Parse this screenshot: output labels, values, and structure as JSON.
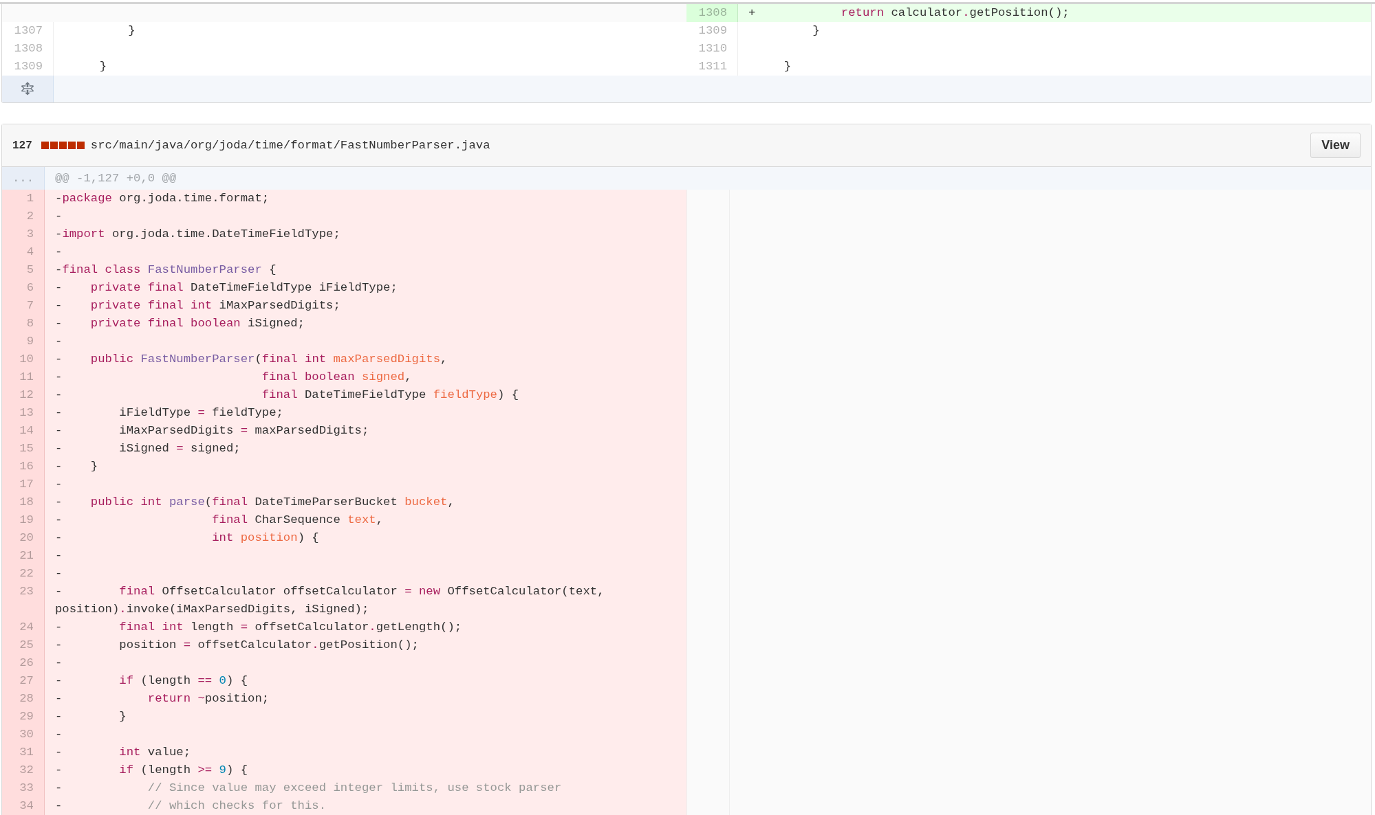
{
  "previous_file_tail": {
    "rows": [
      {
        "right": {
          "kind": "added",
          "number": "1308",
          "code": [
            {
              "kind": "plain",
              "text": "+            "
            },
            {
              "kind": "keyword",
              "text": "return"
            },
            {
              "kind": "plain",
              "text": " calculator"
            },
            {
              "kind": "operator",
              "text": "."
            },
            {
              "kind": "plain",
              "text": "getPosition();"
            }
          ]
        }
      },
      {
        "left": {
          "kind": "context",
          "number": "1307",
          "code": [
            {
              "kind": "plain",
              "text": "         }"
            }
          ]
        },
        "right": {
          "kind": "context",
          "number": "1309",
          "code": [
            {
              "kind": "plain",
              "text": "         }"
            }
          ]
        }
      },
      {
        "left": {
          "kind": "context",
          "number": "1308"
        },
        "right": {
          "kind": "context",
          "number": "1310"
        }
      },
      {
        "left": {
          "kind": "context",
          "number": "1309",
          "code": [
            {
              "kind": "plain",
              "text": "     }"
            }
          ]
        },
        "right": {
          "kind": "context",
          "number": "1311",
          "code": [
            {
              "kind": "plain",
              "text": "     }"
            }
          ]
        }
      }
    ]
  },
  "file": {
    "changes": "127",
    "diffstat": [
      {
        "kind": "deleted"
      },
      {
        "kind": "deleted"
      },
      {
        "kind": "deleted"
      },
      {
        "kind": "deleted"
      },
      {
        "kind": "deleted"
      }
    ],
    "path": "src/main/java/org/joda/time/format/FastNumberParser.java",
    "view_button": "View",
    "hunk": {
      "expander": "...",
      "header": "@@ -1,127 +0,0 @@"
    },
    "lines": [
      {
        "kind": "deleted",
        "number": "1",
        "code": [
          {
            "kind": "plain",
            "text": "-"
          },
          {
            "kind": "keyword",
            "text": "package"
          },
          {
            "kind": "plain",
            "text": " org.joda.time.format;"
          }
        ]
      },
      {
        "kind": "deleted",
        "number": "2",
        "code": [
          {
            "kind": "plain",
            "text": "-"
          }
        ]
      },
      {
        "kind": "deleted",
        "number": "3",
        "code": [
          {
            "kind": "plain",
            "text": "-"
          },
          {
            "kind": "keyword",
            "text": "import"
          },
          {
            "kind": "plain",
            "text": " org.joda.time.DateTimeFieldType;"
          }
        ]
      },
      {
        "kind": "deleted",
        "number": "4",
        "code": [
          {
            "kind": "plain",
            "text": "-"
          }
        ]
      },
      {
        "kind": "deleted",
        "number": "5",
        "code": [
          {
            "kind": "plain",
            "text": "-"
          },
          {
            "kind": "keyword",
            "text": "final"
          },
          {
            "kind": "keyword",
            "text": " class"
          },
          {
            "kind": "entity",
            "text": " FastNumberParser"
          },
          {
            "kind": "plain",
            "text": " {"
          }
        ]
      },
      {
        "kind": "deleted",
        "number": "6",
        "code": [
          {
            "kind": "plain",
            "text": "-    "
          },
          {
            "kind": "keyword",
            "text": "private"
          },
          {
            "kind": "keyword",
            "text": " final"
          },
          {
            "kind": "plain",
            "text": " DateTimeFieldType iFieldType;"
          }
        ]
      },
      {
        "kind": "deleted",
        "number": "7",
        "code": [
          {
            "kind": "plain",
            "text": "-    "
          },
          {
            "kind": "keyword",
            "text": "private"
          },
          {
            "kind": "keyword",
            "text": " final"
          },
          {
            "kind": "keyword",
            "text": " int"
          },
          {
            "kind": "plain",
            "text": " iMaxParsedDigits;"
          }
        ]
      },
      {
        "kind": "deleted",
        "number": "8",
        "code": [
          {
            "kind": "plain",
            "text": "-    "
          },
          {
            "kind": "keyword",
            "text": "private"
          },
          {
            "kind": "keyword",
            "text": " final"
          },
          {
            "kind": "keyword",
            "text": " boolean"
          },
          {
            "kind": "plain",
            "text": " iSigned;"
          }
        ]
      },
      {
        "kind": "deleted",
        "number": "9",
        "code": [
          {
            "kind": "plain",
            "text": "-"
          }
        ]
      },
      {
        "kind": "deleted",
        "number": "10",
        "code": [
          {
            "kind": "plain",
            "text": "-    "
          },
          {
            "kind": "keyword",
            "text": "public"
          },
          {
            "kind": "entity",
            "text": " FastNumberParser"
          },
          {
            "kind": "plain",
            "text": "("
          },
          {
            "kind": "keyword",
            "text": "final"
          },
          {
            "kind": "keyword",
            "text": " int"
          },
          {
            "kind": "parameter",
            "text": " maxParsedDigits"
          },
          {
            "kind": "plain",
            "text": ","
          }
        ]
      },
      {
        "kind": "deleted",
        "number": "11",
        "code": [
          {
            "kind": "plain",
            "text": "-                            "
          },
          {
            "kind": "keyword",
            "text": "final"
          },
          {
            "kind": "keyword",
            "text": " boolean"
          },
          {
            "kind": "parameter",
            "text": " signed"
          },
          {
            "kind": "plain",
            "text": ","
          }
        ]
      },
      {
        "kind": "deleted",
        "number": "12",
        "code": [
          {
            "kind": "plain",
            "text": "-                            "
          },
          {
            "kind": "keyword",
            "text": "final"
          },
          {
            "kind": "plain",
            "text": " DateTimeFieldType "
          },
          {
            "kind": "parameter",
            "text": "fieldType"
          },
          {
            "kind": "plain",
            "text": ") {"
          }
        ]
      },
      {
        "kind": "deleted",
        "number": "13",
        "code": [
          {
            "kind": "plain",
            "text": "-        iFieldType "
          },
          {
            "kind": "operator",
            "text": "="
          },
          {
            "kind": "plain",
            "text": " fieldType;"
          }
        ]
      },
      {
        "kind": "deleted",
        "number": "14",
        "code": [
          {
            "kind": "plain",
            "text": "-        iMaxParsedDigits "
          },
          {
            "kind": "operator",
            "text": "="
          },
          {
            "kind": "plain",
            "text": " maxParsedDigits;"
          }
        ]
      },
      {
        "kind": "deleted",
        "number": "15",
        "code": [
          {
            "kind": "plain",
            "text": "-        iSigned "
          },
          {
            "kind": "operator",
            "text": "="
          },
          {
            "kind": "plain",
            "text": " signed;"
          }
        ]
      },
      {
        "kind": "deleted",
        "number": "16",
        "code": [
          {
            "kind": "plain",
            "text": "-    }"
          }
        ]
      },
      {
        "kind": "deleted",
        "number": "17",
        "code": [
          {
            "kind": "plain",
            "text": "-"
          }
        ]
      },
      {
        "kind": "deleted",
        "number": "18",
        "code": [
          {
            "kind": "plain",
            "text": "-    "
          },
          {
            "kind": "keyword",
            "text": "public"
          },
          {
            "kind": "keyword",
            "text": " int"
          },
          {
            "kind": "entity",
            "text": " parse"
          },
          {
            "kind": "plain",
            "text": "("
          },
          {
            "kind": "keyword",
            "text": "final"
          },
          {
            "kind": "plain",
            "text": " DateTimeParserBucket "
          },
          {
            "kind": "parameter",
            "text": "bucket"
          },
          {
            "kind": "plain",
            "text": ","
          }
        ]
      },
      {
        "kind": "deleted",
        "number": "19",
        "code": [
          {
            "kind": "plain",
            "text": "-                     "
          },
          {
            "kind": "keyword",
            "text": "final"
          },
          {
            "kind": "plain",
            "text": " CharSequence "
          },
          {
            "kind": "parameter",
            "text": "text"
          },
          {
            "kind": "plain",
            "text": ","
          }
        ]
      },
      {
        "kind": "deleted",
        "number": "20",
        "code": [
          {
            "kind": "plain",
            "text": "-                     "
          },
          {
            "kind": "keyword",
            "text": "int"
          },
          {
            "kind": "parameter",
            "text": " position"
          },
          {
            "kind": "plain",
            "text": ") {"
          }
        ]
      },
      {
        "kind": "deleted",
        "number": "21",
        "code": [
          {
            "kind": "plain",
            "text": "-"
          }
        ]
      },
      {
        "kind": "deleted",
        "number": "22",
        "code": [
          {
            "kind": "plain",
            "text": "-"
          }
        ]
      },
      {
        "kind": "deleted",
        "number": "23",
        "code": [
          {
            "kind": "plain",
            "text": "-        "
          },
          {
            "kind": "keyword",
            "text": "final"
          },
          {
            "kind": "plain",
            "text": " OffsetCalculator offsetCalculator "
          },
          {
            "kind": "operator",
            "text": "="
          },
          {
            "kind": "keyword",
            "text": " new"
          },
          {
            "kind": "plain",
            "text": " OffsetCalculator(text, position)"
          },
          {
            "kind": "operator",
            "text": "."
          },
          {
            "kind": "plain",
            "text": "invoke(iMaxParsedDigits, iSigned);"
          }
        ]
      },
      {
        "kind": "deleted",
        "number": "24",
        "code": [
          {
            "kind": "plain",
            "text": "-        "
          },
          {
            "kind": "keyword",
            "text": "final"
          },
          {
            "kind": "keyword",
            "text": " int"
          },
          {
            "kind": "plain",
            "text": " length "
          },
          {
            "kind": "operator",
            "text": "="
          },
          {
            "kind": "plain",
            "text": " offsetCalculator"
          },
          {
            "kind": "operator",
            "text": "."
          },
          {
            "kind": "plain",
            "text": "getLength();"
          }
        ]
      },
      {
        "kind": "deleted",
        "number": "25",
        "code": [
          {
            "kind": "plain",
            "text": "-        position "
          },
          {
            "kind": "operator",
            "text": "="
          },
          {
            "kind": "plain",
            "text": " offsetCalculator"
          },
          {
            "kind": "operator",
            "text": "."
          },
          {
            "kind": "plain",
            "text": "getPosition();"
          }
        ]
      },
      {
        "kind": "deleted",
        "number": "26",
        "code": [
          {
            "kind": "plain",
            "text": "-"
          }
        ]
      },
      {
        "kind": "deleted",
        "number": "27",
        "code": [
          {
            "kind": "plain",
            "text": "-        "
          },
          {
            "kind": "keyword",
            "text": "if"
          },
          {
            "kind": "plain",
            "text": " (length "
          },
          {
            "kind": "operator",
            "text": "=="
          },
          {
            "kind": "number",
            "text": " 0"
          },
          {
            "kind": "plain",
            "text": ") {"
          }
        ]
      },
      {
        "kind": "deleted",
        "number": "28",
        "code": [
          {
            "kind": "plain",
            "text": "-            "
          },
          {
            "kind": "keyword",
            "text": "return"
          },
          {
            "kind": "operator",
            "text": " ~"
          },
          {
            "kind": "plain",
            "text": "position;"
          }
        ]
      },
      {
        "kind": "deleted",
        "number": "29",
        "code": [
          {
            "kind": "plain",
            "text": "-        }"
          }
        ]
      },
      {
        "kind": "deleted",
        "number": "30",
        "code": [
          {
            "kind": "plain",
            "text": "-"
          }
        ]
      },
      {
        "kind": "deleted",
        "number": "31",
        "code": [
          {
            "kind": "plain",
            "text": "-        "
          },
          {
            "kind": "keyword",
            "text": "int"
          },
          {
            "kind": "plain",
            "text": " value;"
          }
        ]
      },
      {
        "kind": "deleted",
        "number": "32",
        "code": [
          {
            "kind": "plain",
            "text": "-        "
          },
          {
            "kind": "keyword",
            "text": "if"
          },
          {
            "kind": "plain",
            "text": " (length "
          },
          {
            "kind": "operator",
            "text": ">="
          },
          {
            "kind": "number",
            "text": " 9"
          },
          {
            "kind": "plain",
            "text": ") {"
          }
        ]
      },
      {
        "kind": "deleted",
        "number": "33",
        "code": [
          {
            "kind": "plain",
            "text": "-            "
          },
          {
            "kind": "comment",
            "text": "// Since value may exceed integer limits, use stock parser"
          }
        ]
      },
      {
        "kind": "deleted",
        "number": "34",
        "code": [
          {
            "kind": "plain",
            "text": "-            "
          },
          {
            "kind": "comment",
            "text": "// which checks for this."
          }
        ]
      }
    ]
  }
}
